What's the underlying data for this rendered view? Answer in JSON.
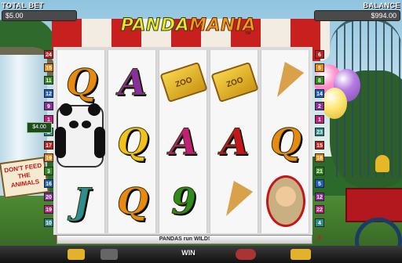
{
  "header": {
    "total_bet_label": "TOTAL BET",
    "total_bet_value": "$5.00",
    "balance_label": "BALANCE",
    "balance_value": "$994.00"
  },
  "logo": {
    "part1": "PANDA",
    "part2": "MANIA",
    "tm": "TM"
  },
  "reels": [
    [
      "Q",
      "panda",
      "J"
    ],
    [
      "A",
      "Q",
      "Q"
    ],
    [
      "ZOO",
      "A",
      "9"
    ],
    [
      "ZOO",
      "A",
      "ice-cream"
    ],
    [
      "ice-cream",
      "Q",
      "zookeeper"
    ]
  ],
  "ticket_text": "ZOO",
  "paylines_left": [
    "24",
    "15",
    "11",
    "12",
    "9",
    "1",
    "2",
    "17",
    "19",
    "3",
    "16",
    "20",
    "19",
    "10"
  ],
  "paylines_right": [
    "6",
    "5",
    "8",
    "14",
    "2",
    "1",
    "23",
    "15",
    "18",
    "21",
    "5",
    "12",
    "22",
    "4"
  ],
  "bet_tag": "$4.00",
  "x_left": "X",
  "x_right": "X",
  "sign_text": "DON'T FEED THE ANIMALS",
  "message": "PANDAS run WILD!",
  "win_label": "WIN",
  "colors": {
    "accent": "#c2161a",
    "frame": "#e2e2e2",
    "bar": "#111111"
  }
}
